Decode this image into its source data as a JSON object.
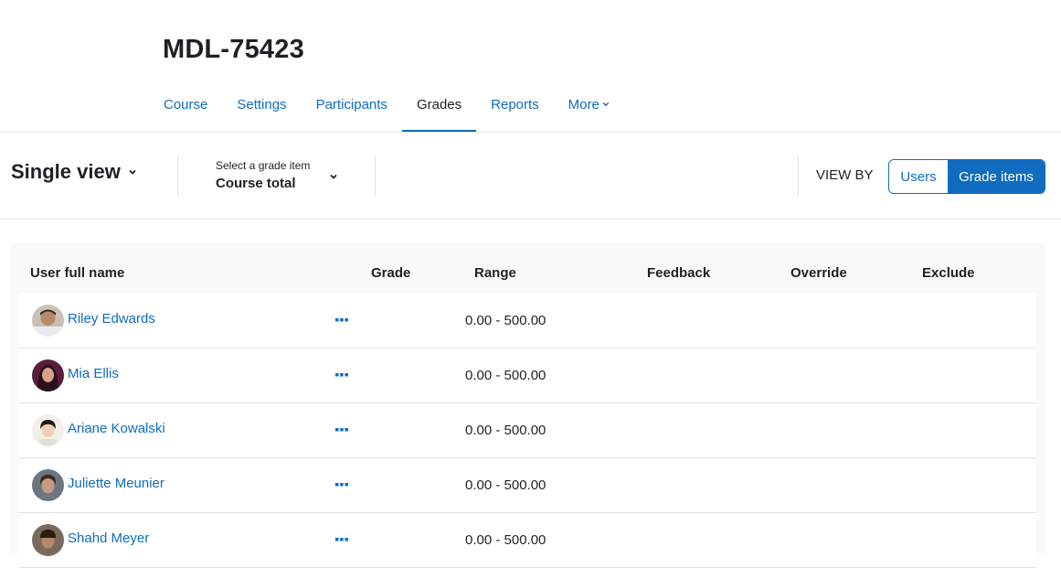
{
  "course": {
    "title": "MDL-75423"
  },
  "secondary_nav": {
    "tabs": [
      {
        "label": "Course",
        "active": false
      },
      {
        "label": "Settings",
        "active": false
      },
      {
        "label": "Participants",
        "active": false
      },
      {
        "label": "Grades",
        "active": true
      },
      {
        "label": "Reports",
        "active": false
      },
      {
        "label": "More",
        "active": false,
        "icon": "chevron-down-icon"
      }
    ]
  },
  "tertiary": {
    "page_selector": {
      "label": "Single view",
      "icon": "chevron-down-icon"
    },
    "grade_item": {
      "caption": "Select a grade item",
      "value": "Course total",
      "icon": "chevron-down-icon"
    },
    "view_by": {
      "label": "VIEW BY",
      "users_label": "Users",
      "items_label": "Grade items",
      "selected": "Grade items"
    }
  },
  "table": {
    "headers": {
      "name": "User full name",
      "grade": "Grade",
      "range": "Range",
      "feedback": "Feedback",
      "override": "Override",
      "exclude": "Exclude"
    },
    "rows": [
      {
        "name": "Riley Edwards",
        "range": "0.00 - 500.00"
      },
      {
        "name": "Mia Ellis",
        "range": "0.00 - 500.00"
      },
      {
        "name": "Ariane Kowalski",
        "range": "0.00 - 500.00"
      },
      {
        "name": "Juliette Meunier",
        "range": "0.00 - 500.00"
      },
      {
        "name": "Shahd Meyer",
        "range": "0.00 - 500.00"
      }
    ]
  },
  "colors": {
    "link": "#0f6cbf",
    "text": "#1d2125",
    "border": "#dee2e6",
    "panel_bg": "#f8f9fa"
  }
}
